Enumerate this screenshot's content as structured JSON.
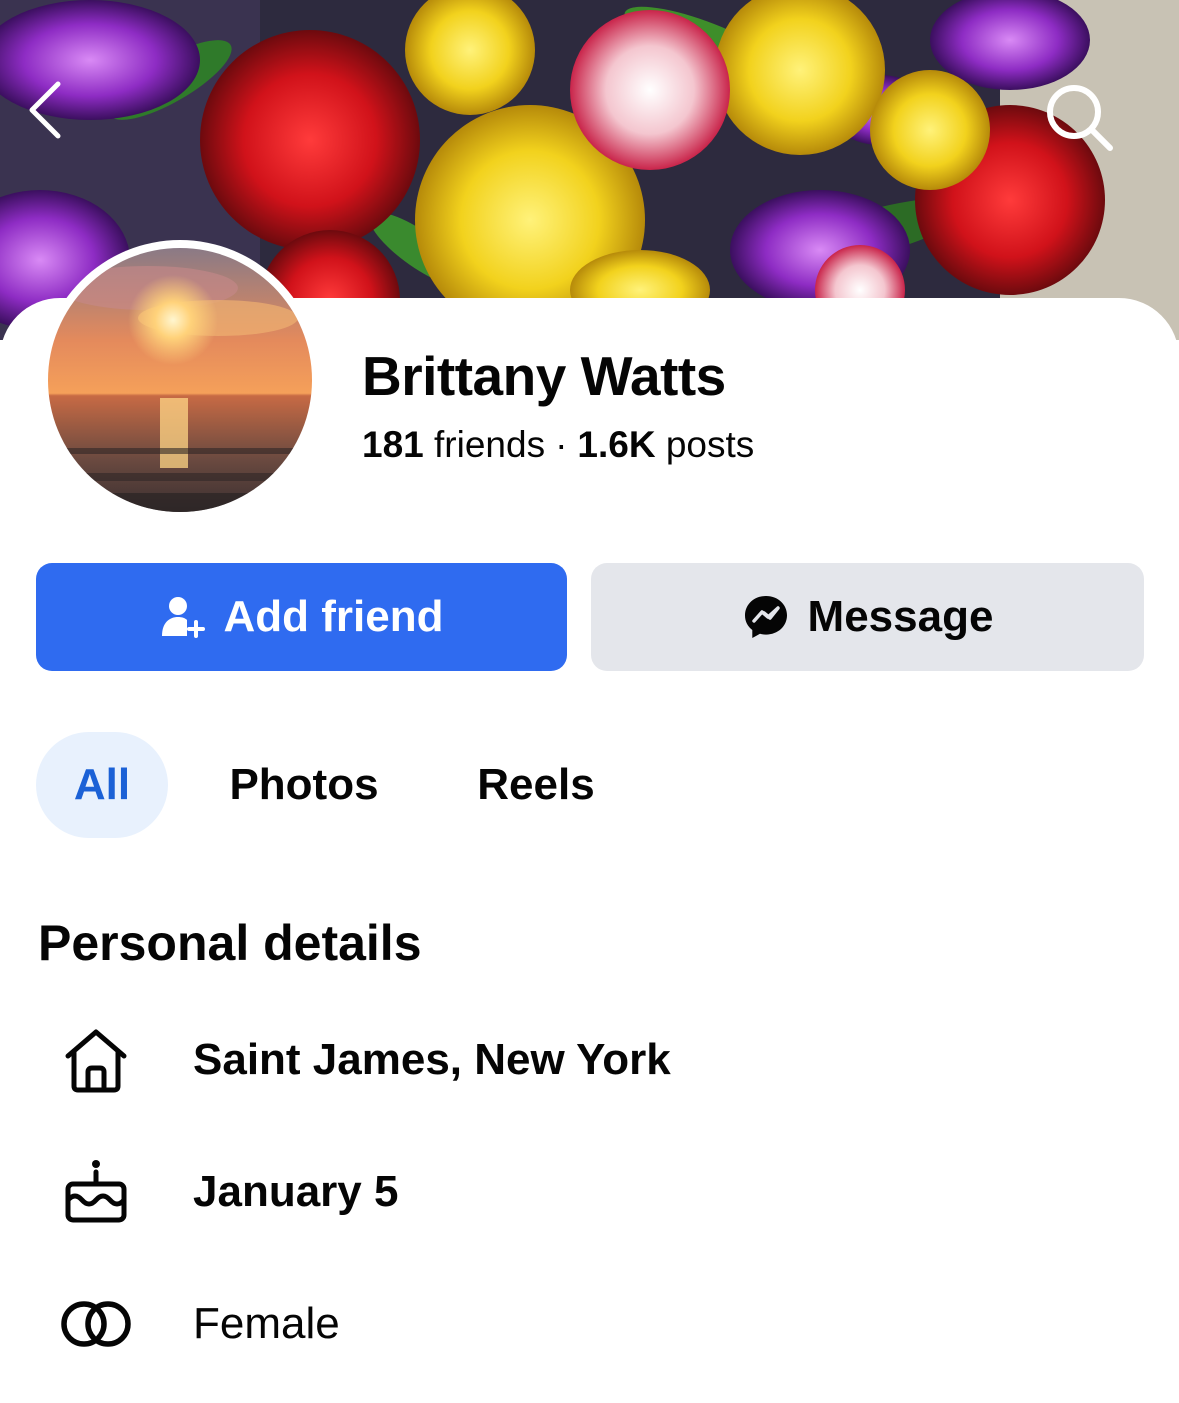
{
  "profile": {
    "name": "Brittany Watts",
    "friends_count": "181",
    "friends_label": "friends",
    "separator": "·",
    "posts_count": "1.6K",
    "posts_label": "posts"
  },
  "cover": {
    "back_icon": "chevron-left-icon",
    "search_icon": "search-icon"
  },
  "actions": {
    "add_friend_label": "Add friend",
    "add_friend_icon": "add-person-icon",
    "message_label": "Message",
    "message_icon": "messenger-icon"
  },
  "tabs": [
    {
      "label": "All",
      "selected": true
    },
    {
      "label": "Photos",
      "selected": false
    },
    {
      "label": "Reels",
      "selected": false
    }
  ],
  "details": {
    "title": "Personal details",
    "items": [
      {
        "icon": "home-icon",
        "text": "Saint James, New York"
      },
      {
        "icon": "birthday-cake-icon",
        "text": "January 5"
      },
      {
        "icon": "gender-rings-icon",
        "text": "Female"
      }
    ]
  },
  "colors": {
    "primary": "#2f6bf0",
    "secondary_button": "#e4e6eb",
    "selected_tab_bg": "#e8f1fd",
    "selected_tab_text": "#1b61d6",
    "text": "#050505"
  }
}
